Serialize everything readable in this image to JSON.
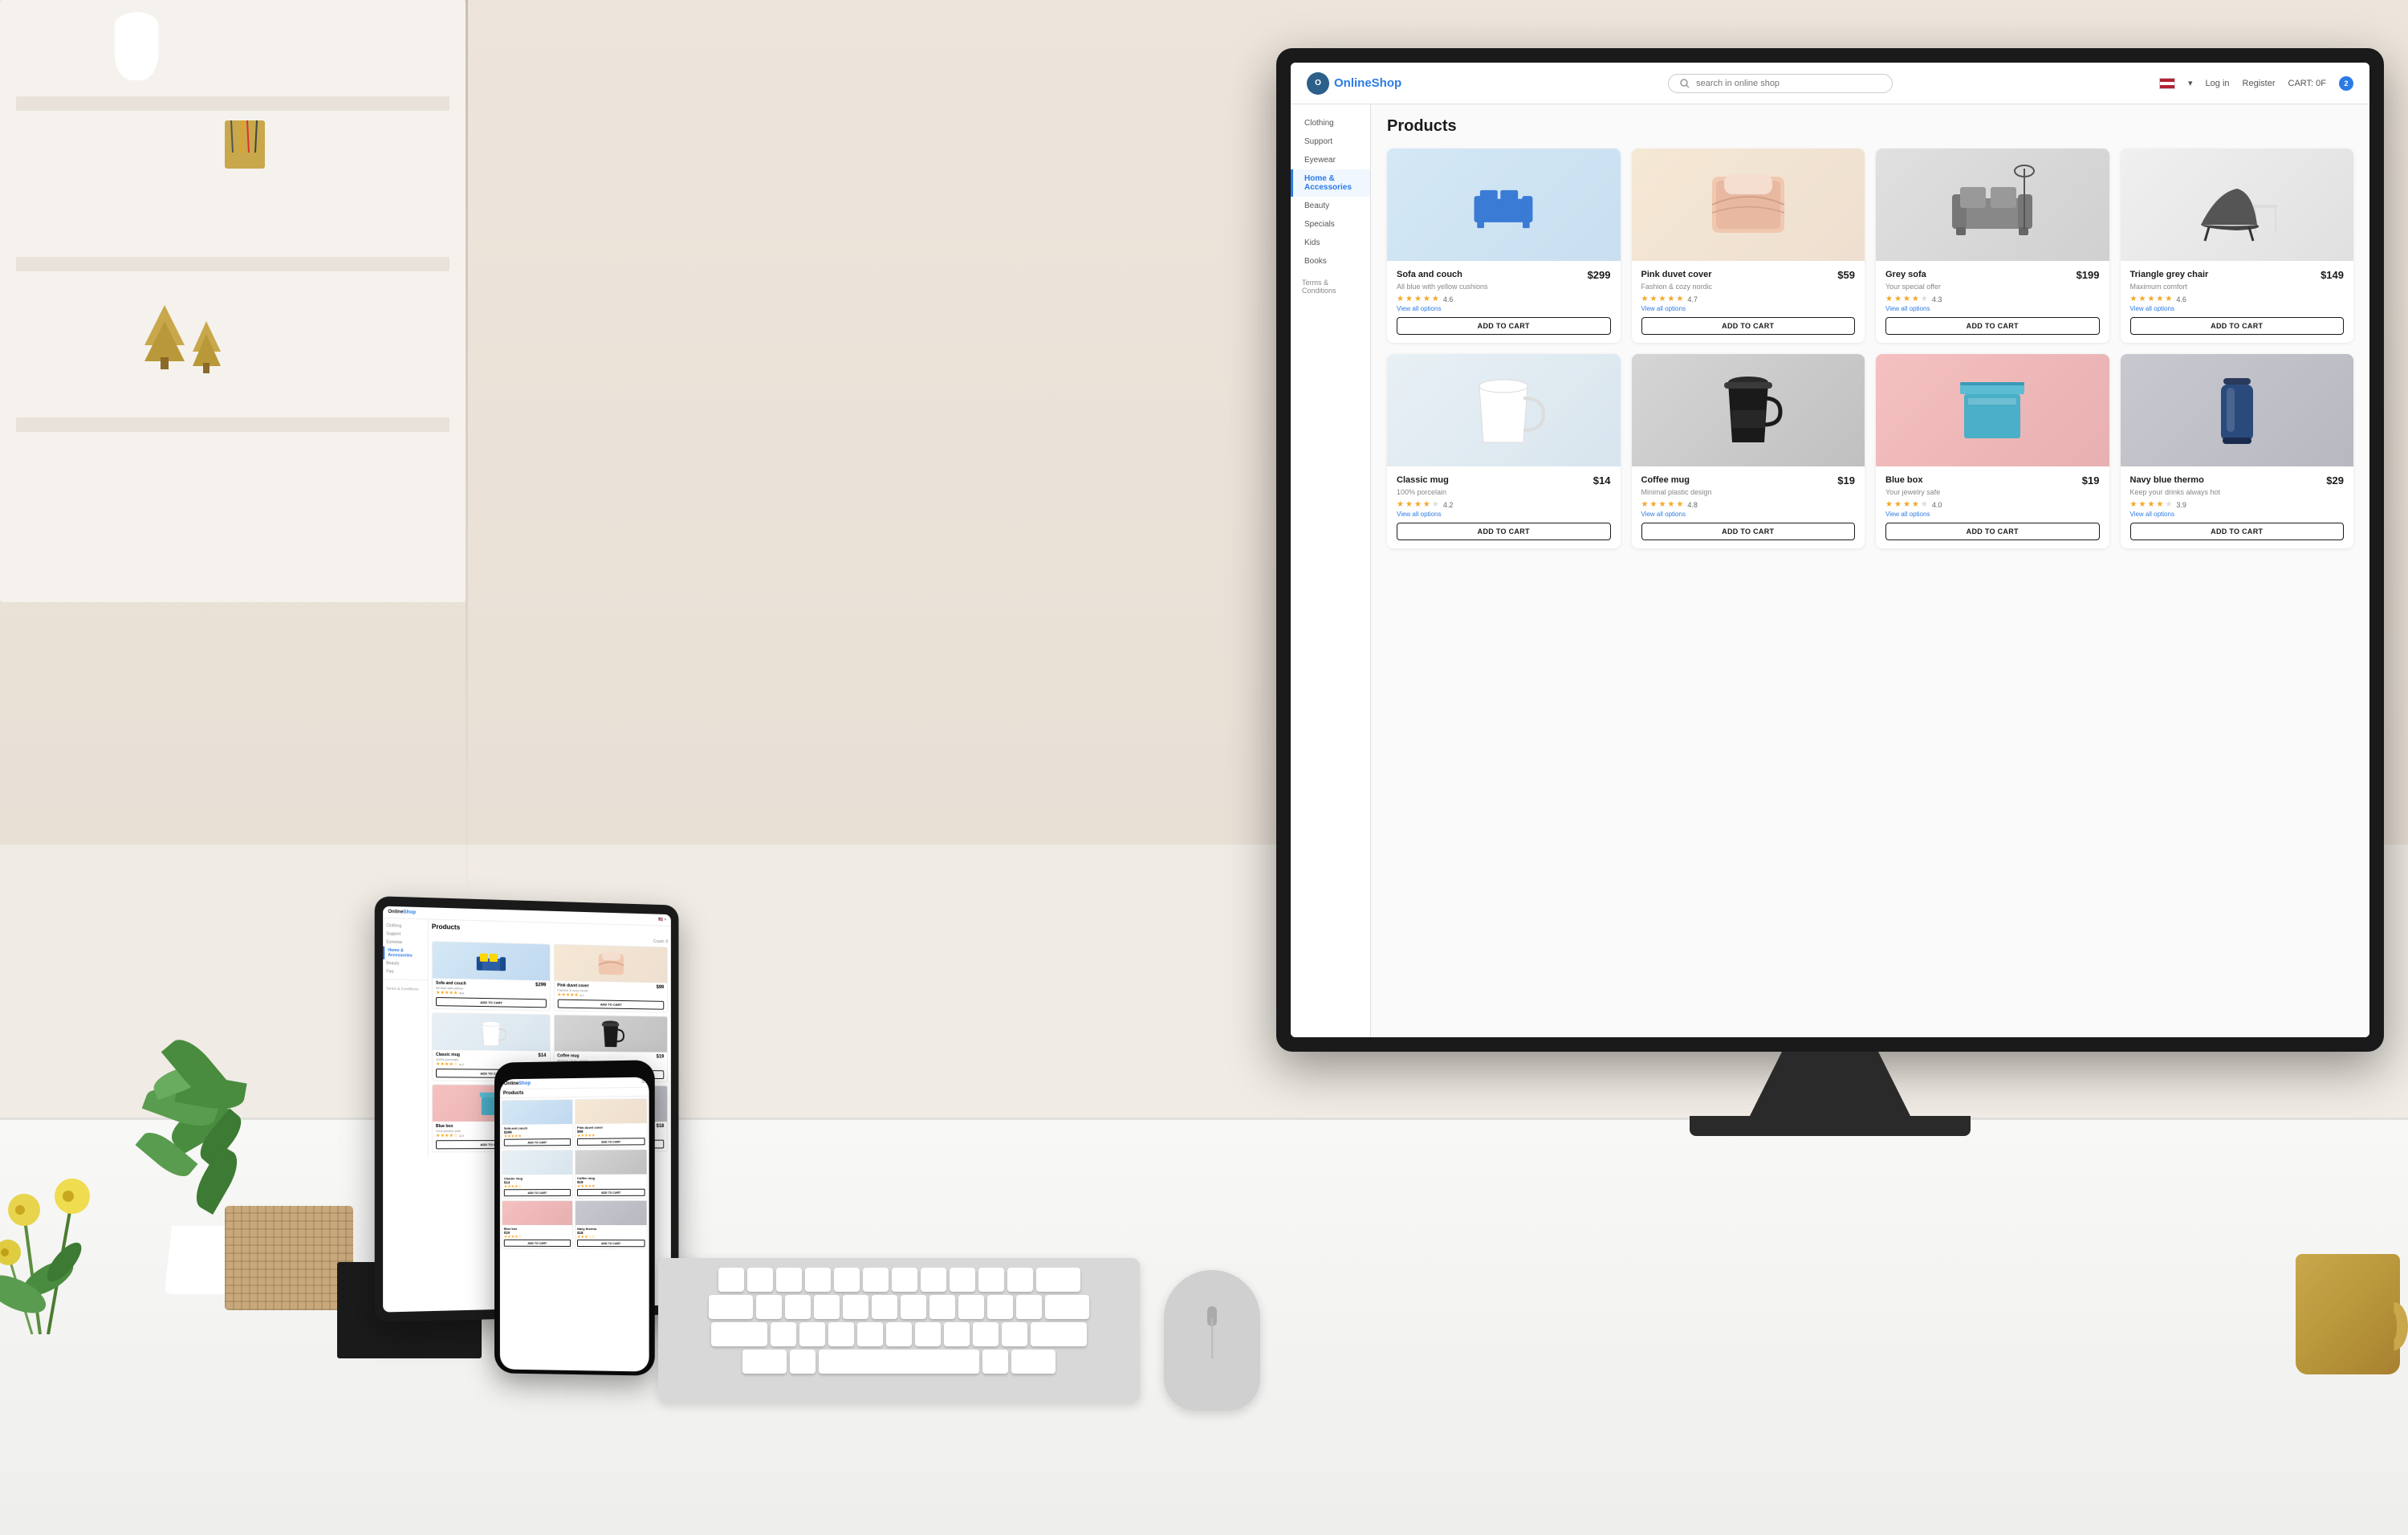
{
  "site": {
    "name": "OnlineShop",
    "logo_letter": "O",
    "search_placeholder": "search in online shop",
    "nav_links": [
      "Log in",
      "Register"
    ],
    "cart_label": "CART: 0F",
    "cart_count": "2"
  },
  "header": {
    "flag": "US",
    "login": "Log in",
    "register": "Register",
    "cart": "CART: 0F",
    "cart_count": "2"
  },
  "sidebar": {
    "items": [
      {
        "label": "Clothing",
        "active": false
      },
      {
        "label": "Support",
        "active": false
      },
      {
        "label": "Eyewear",
        "active": false
      },
      {
        "label": "Home & Accessories",
        "active": true
      },
      {
        "label": "Beauty",
        "active": false
      },
      {
        "label": "Specials",
        "active": false
      },
      {
        "label": "Kids",
        "active": false
      },
      {
        "label": "Books",
        "active": false
      }
    ]
  },
  "products": {
    "section_title": "Products",
    "items": [
      {
        "id": "sofa-couch",
        "name": "Sofa and couch",
        "desc": "All blue with yellow cushions",
        "price": "$299",
        "rating": 4.6,
        "stars": [
          1,
          1,
          1,
          1,
          0.6
        ],
        "image_type": "sofa",
        "bg_color": "#d4e8f5",
        "view_all": "View all options",
        "add_to_cart": "ADD TO CART"
      },
      {
        "id": "pink-duvet",
        "name": "Pink duvet cover",
        "desc": "Fashion & cozy nordic",
        "price": "$59",
        "rating": 4.7,
        "stars": [
          1,
          1,
          1,
          1,
          0.7
        ],
        "image_type": "duvet",
        "bg_color": "#f5e8d4",
        "view_all": "View all options",
        "add_to_cart": "ADD TO CART"
      },
      {
        "id": "grey-sofa",
        "name": "Grey sofa",
        "desc": "Your special offer",
        "price": "$199",
        "rating": 4.3,
        "stars": [
          1,
          1,
          1,
          1,
          0.3
        ],
        "image_type": "grey-sofa",
        "bg_color": "#e0e0e0",
        "view_all": "View all options",
        "add_to_cart": "ADD TO CART"
      },
      {
        "id": "triangle-chair",
        "name": "Triangle grey chair",
        "desc": "Maximum comfort",
        "price": "$149",
        "rating": 4.6,
        "stars": [
          1,
          1,
          1,
          1,
          0.6
        ],
        "image_type": "triangle-chair",
        "bg_color": "#f0f0f0",
        "view_all": "View all options",
        "add_to_cart": "ADD TO CART"
      },
      {
        "id": "classic-mug",
        "name": "Classic mug",
        "desc": "100% porcelain",
        "price": "$14",
        "rating": 4.2,
        "stars": [
          1,
          1,
          1,
          1,
          0.2
        ],
        "image_type": "classic-mug",
        "bg_color": "#e8f0f5",
        "view_all": "View all options",
        "add_to_cart": "ADD TO CART"
      },
      {
        "id": "coffee-mug",
        "name": "Coffee mug",
        "desc": "Minimal plastic design",
        "price": "$19",
        "rating": 4.8,
        "stars": [
          1,
          1,
          1,
          1,
          0.8
        ],
        "image_type": "coffee-mug",
        "bg_color": "#d5d5d5",
        "view_all": "View all options",
        "add_to_cart": "ADD TO CART"
      },
      {
        "id": "blue-box",
        "name": "Blue box",
        "desc": "Your jewelry safe",
        "price": "$19",
        "rating": 4.0,
        "stars": [
          1,
          1,
          1,
          1,
          0
        ],
        "image_type": "blue-box",
        "bg_color": "#f5c0c0",
        "view_all": "View all options",
        "add_to_cart": "ADD TO CART"
      },
      {
        "id": "navy-thermo",
        "name": "Navy blue thermo",
        "desc": "Keep your drinks always hot",
        "price": "$29",
        "rating": 3.9,
        "stars": [
          1,
          1,
          1,
          0.9,
          0
        ],
        "image_type": "navy-thermo",
        "bg_color": "#c8c8d0",
        "view_all": "View all options",
        "add_to_cart": "ADD TO CART"
      }
    ]
  },
  "colors": {
    "primary": "#2c7be5",
    "dark": "#1a1a1a",
    "star_gold": "#f5a623",
    "border": "#e0e0e0"
  }
}
